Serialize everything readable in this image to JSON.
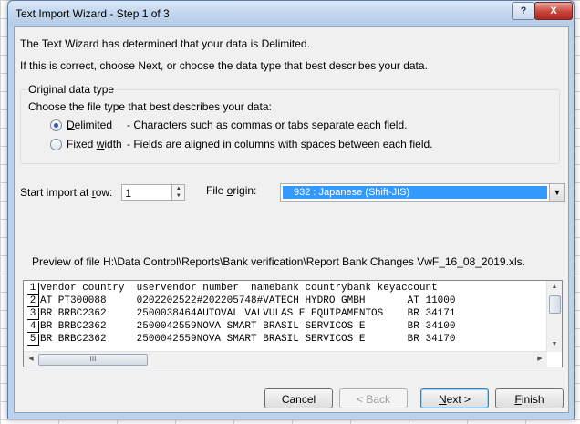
{
  "window": {
    "title": "Text Import Wizard - Step 1 of 3",
    "help_label": "?",
    "close_label": "X"
  },
  "intro": {
    "line1": "The Text Wizard has determined that your data is Delimited.",
    "line2": "If this is correct, choose Next, or choose the data type that best describes your data."
  },
  "original_data_type": {
    "legend": "Original data type",
    "prompt": "Choose the file type that best describes your data:",
    "options": [
      {
        "label_pre": "",
        "label_u": "D",
        "label_post": "elimited",
        "description": "- Characters such as commas or tabs separate each field.",
        "selected": true
      },
      {
        "label_pre": "Fixed ",
        "label_u": "w",
        "label_post": "idth",
        "description": "- Fields are aligned in columns with spaces between each field.",
        "selected": false
      }
    ]
  },
  "start_row": {
    "label_pre": "Start import at ",
    "label_u": "r",
    "label_post": "ow:",
    "value": "1"
  },
  "file_origin": {
    "label_pre": "File ",
    "label_u": "o",
    "label_post": "rigin:",
    "value": "932 : Japanese (Shift-JIS)"
  },
  "preview": {
    "label": "Preview of file H:\\Data Control\\Reports\\Bank verification\\Report Bank Changes VwF_16_08_2019.xls.",
    "rows": [
      {
        "num": "1",
        "text": "vendor country  uservendor number  namebank countrybank keyaccount"
      },
      {
        "num": "2",
        "text": "AT PT300088     0202202522#202205748#VATECH HYDRO GMBH       AT 11000"
      },
      {
        "num": "3",
        "text": "BR BRBC2362     2500038464AUTOVAL VALVULAS E EQUIPAMENTOS    BR 34171"
      },
      {
        "num": "4",
        "text": "BR BRBC2362     2500042559NOVA SMART BRASIL SERVICOS E       BR 34100"
      },
      {
        "num": "5",
        "text": "BR BRBC2362     2500042559NOVA SMART BRASIL SERVICOS E       BR 34170"
      }
    ],
    "hscroll_thumb_glyph": "III"
  },
  "buttons": {
    "cancel": "Cancel",
    "back": "< Back",
    "next_u": "N",
    "next_post": "ext >",
    "finish_u": "F",
    "finish_post": "inish"
  }
}
